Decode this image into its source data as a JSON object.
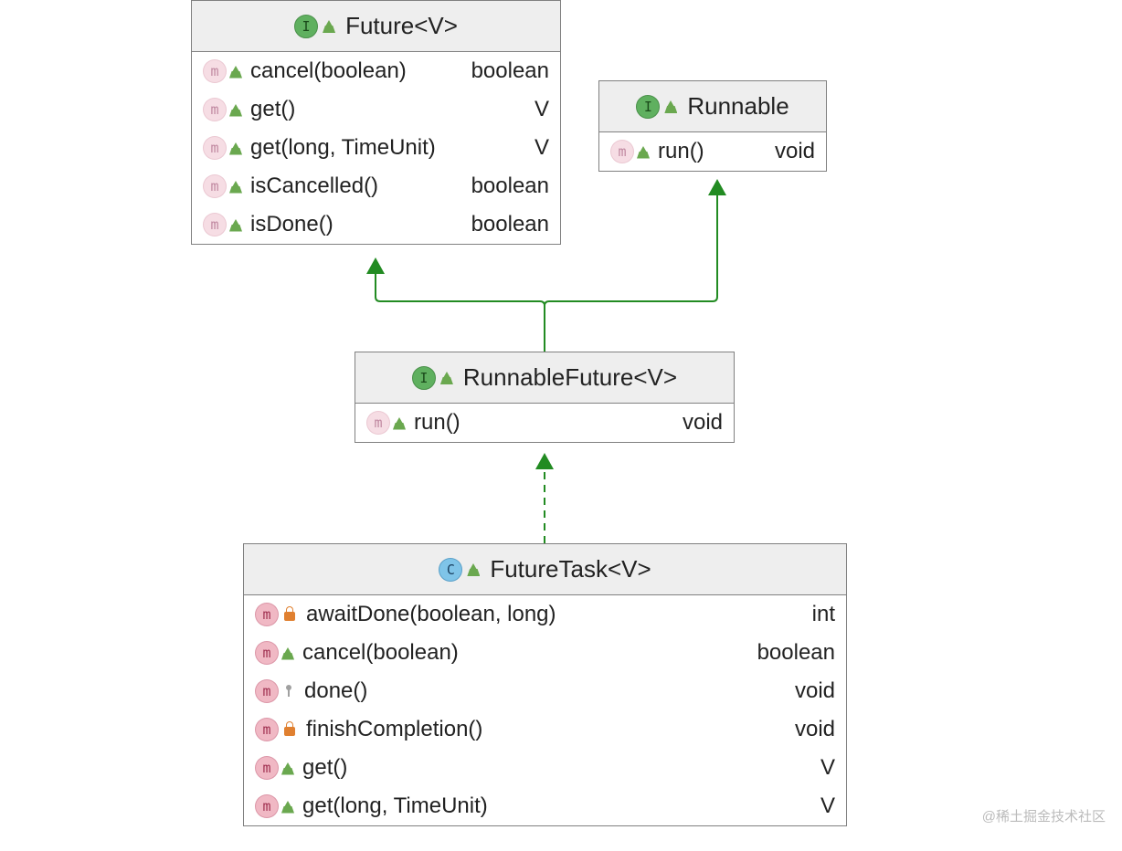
{
  "watermark": "@稀土掘金技术社区",
  "boxes": {
    "future": {
      "kind": "I",
      "title": "Future<V>",
      "rows": [
        {
          "badge": "m",
          "inherited": true,
          "vis": "public",
          "sig": "cancel(boolean)",
          "ret": "boolean"
        },
        {
          "badge": "m",
          "inherited": true,
          "vis": "public",
          "sig": "get()",
          "ret": "V"
        },
        {
          "badge": "m",
          "inherited": true,
          "vis": "public",
          "sig": "get(long, TimeUnit)",
          "ret": "V"
        },
        {
          "badge": "m",
          "inherited": true,
          "vis": "public",
          "sig": "isCancelled()",
          "ret": "boolean"
        },
        {
          "badge": "m",
          "inherited": true,
          "vis": "public",
          "sig": "isDone()",
          "ret": "boolean"
        }
      ]
    },
    "runnable": {
      "kind": "I",
      "title": "Runnable",
      "rows": [
        {
          "badge": "m",
          "inherited": true,
          "vis": "public",
          "sig": "run()",
          "ret": "void"
        }
      ]
    },
    "runnablefuture": {
      "kind": "I",
      "title": "RunnableFuture<V>",
      "rows": [
        {
          "badge": "m",
          "inherited": true,
          "vis": "public",
          "sig": "run()",
          "ret": "void"
        }
      ]
    },
    "futuretask": {
      "kind": "C",
      "title": "FutureTask<V>",
      "rows": [
        {
          "badge": "m",
          "inherited": false,
          "vis": "private",
          "sig": "awaitDone(boolean, long)",
          "ret": "int"
        },
        {
          "badge": "m",
          "inherited": false,
          "vis": "public",
          "sig": "cancel(boolean)",
          "ret": "boolean"
        },
        {
          "badge": "m",
          "inherited": false,
          "vis": "protected",
          "sig": "done()",
          "ret": "void"
        },
        {
          "badge": "m",
          "inherited": false,
          "vis": "private",
          "sig": "finishCompletion()",
          "ret": "void"
        },
        {
          "badge": "m",
          "inherited": false,
          "vis": "public",
          "sig": "get()",
          "ret": "V"
        },
        {
          "badge": "m",
          "inherited": false,
          "vis": "public",
          "sig": "get(long, TimeUnit)",
          "ret": "V"
        }
      ]
    }
  }
}
